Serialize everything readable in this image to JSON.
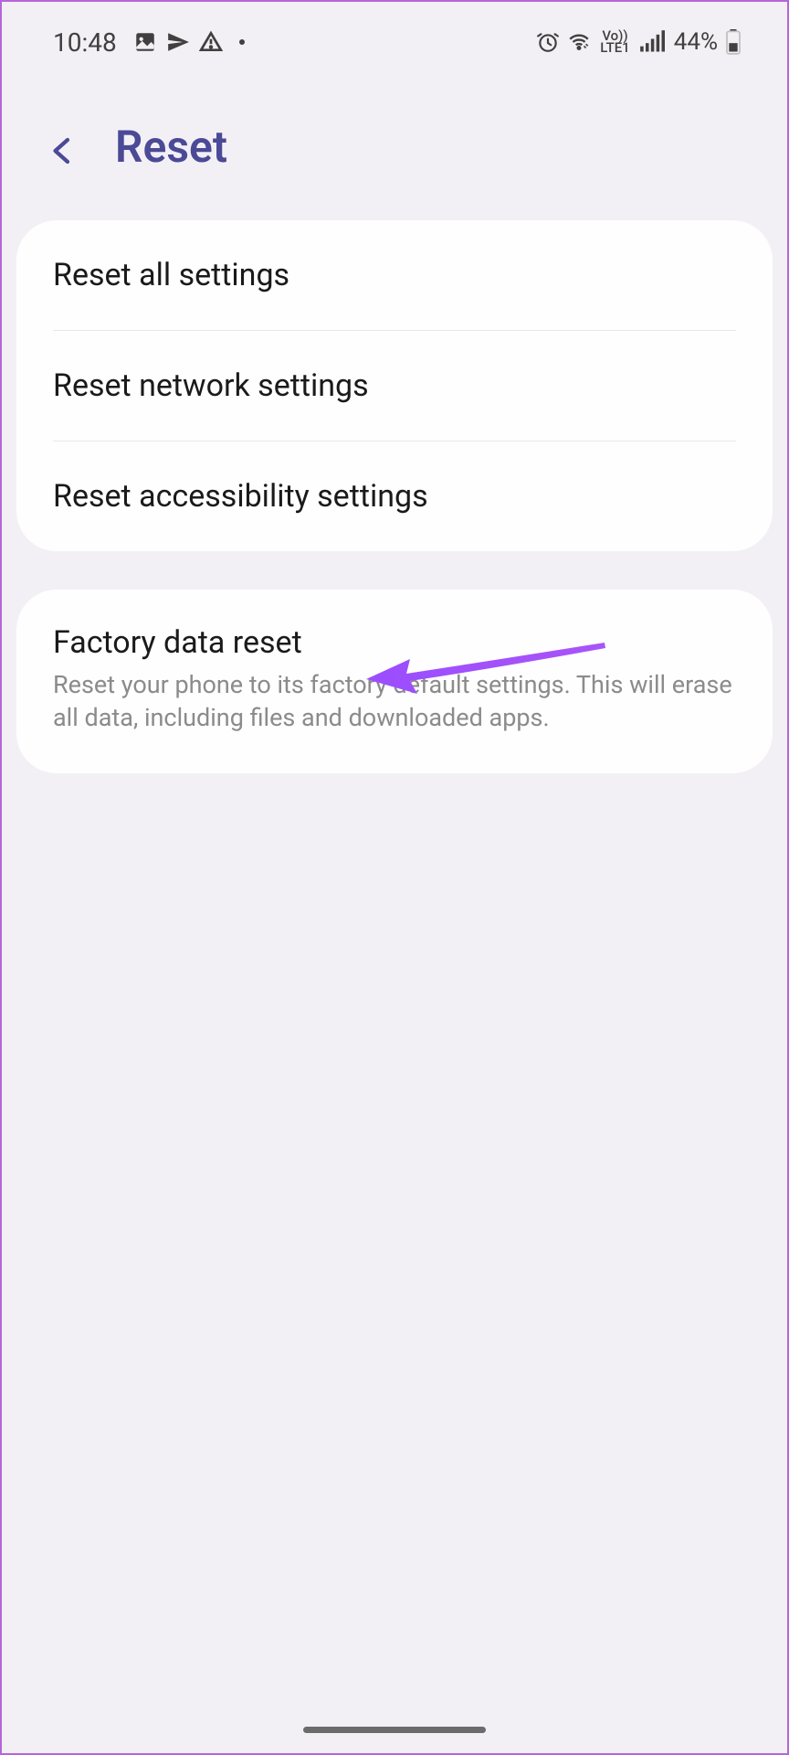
{
  "status_bar": {
    "time": "10:48",
    "battery_percent": "44%",
    "lte_top": "Vo))",
    "lte_bottom": "LTE1"
  },
  "header": {
    "title": "Reset"
  },
  "reset_options": {
    "items": [
      {
        "title": "Reset all settings"
      },
      {
        "title": "Reset network settings"
      },
      {
        "title": "Reset accessibility settings"
      }
    ]
  },
  "factory_reset": {
    "title": "Factory data reset",
    "subtitle": "Reset your phone to its factory default settings. This will erase all data, including files and downloaded apps."
  }
}
